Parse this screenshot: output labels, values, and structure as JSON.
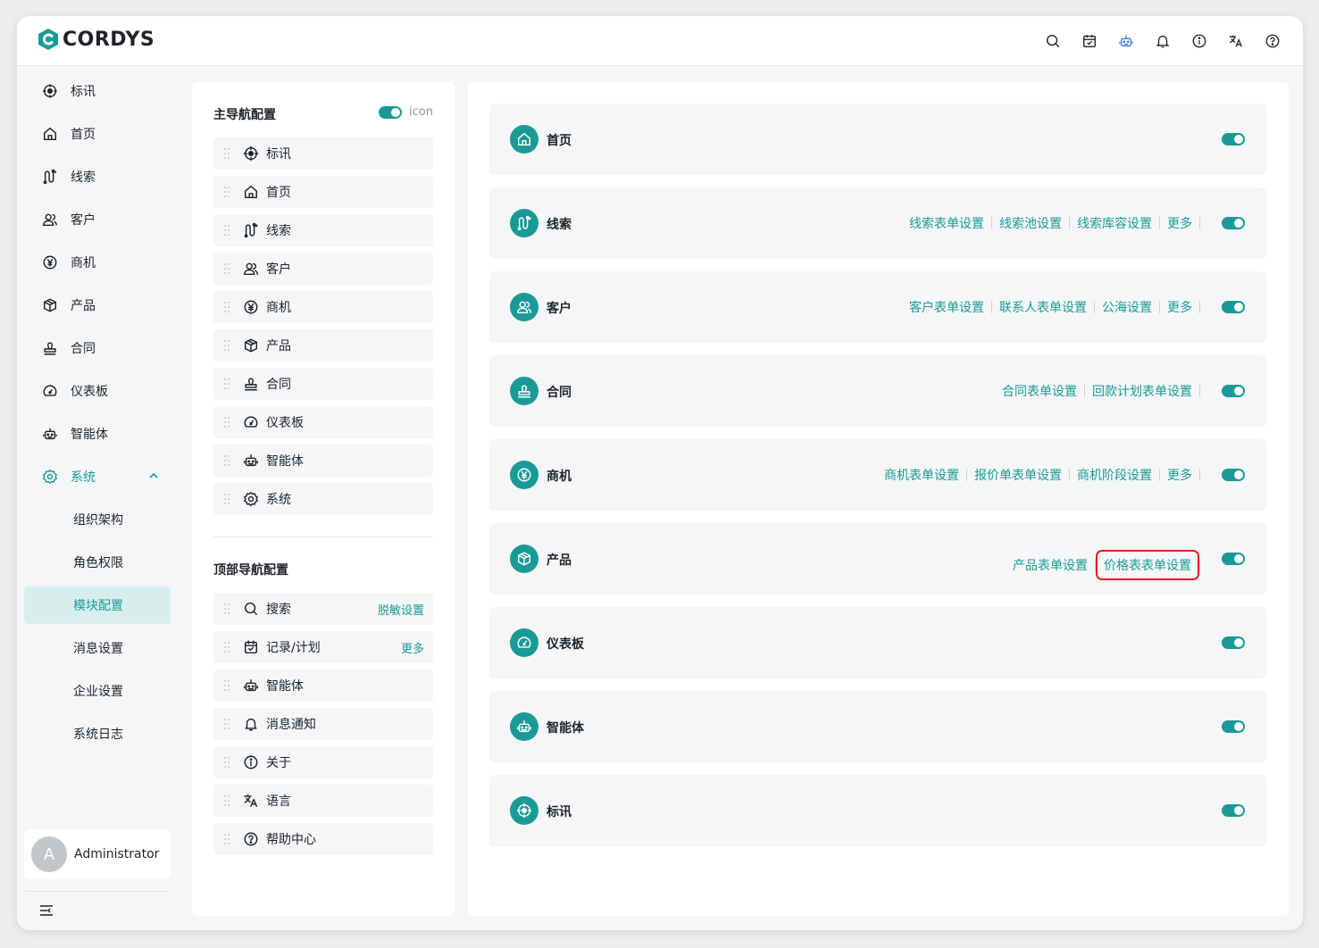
{
  "app": {
    "brand": "CORDYS",
    "accent_color": "#1a9a96"
  },
  "header": {
    "icons": [
      "search-icon",
      "calendar-check-icon",
      "robot-icon",
      "bell-icon",
      "info-icon",
      "translate-icon",
      "help-icon"
    ]
  },
  "sidebar": {
    "items": [
      {
        "label": "标讯",
        "icon": "target-icon"
      },
      {
        "label": "首页",
        "icon": "home-icon"
      },
      {
        "label": "线索",
        "icon": "route-icon"
      },
      {
        "label": "客户",
        "icon": "users-icon"
      },
      {
        "label": "商机",
        "icon": "yen-icon"
      },
      {
        "label": "产品",
        "icon": "box-icon"
      },
      {
        "label": "合同",
        "icon": "stamp-icon"
      },
      {
        "label": "仪表板",
        "icon": "dashboard-icon"
      },
      {
        "label": "智能体",
        "icon": "robot-icon"
      },
      {
        "label": "系统",
        "icon": "gear-icon",
        "expanded": true
      }
    ],
    "sub_items": [
      {
        "label": "组织架构"
      },
      {
        "label": "角色权限"
      },
      {
        "label": "模块配置",
        "active": true
      },
      {
        "label": "消息设置"
      },
      {
        "label": "企业设置"
      },
      {
        "label": "系统日志"
      }
    ],
    "user": {
      "avatar_letter": "A",
      "name": "Administrator"
    }
  },
  "main_nav": {
    "title": "主导航配置",
    "icon_toggle_label": "icon",
    "icon_toggle_on": true,
    "items": [
      {
        "label": "标讯",
        "icon": "target-icon"
      },
      {
        "label": "首页",
        "icon": "home-icon"
      },
      {
        "label": "线索",
        "icon": "route-icon"
      },
      {
        "label": "客户",
        "icon": "users-icon"
      },
      {
        "label": "商机",
        "icon": "yen-icon"
      },
      {
        "label": "产品",
        "icon": "box-icon"
      },
      {
        "label": "合同",
        "icon": "stamp-icon"
      },
      {
        "label": "仪表板",
        "icon": "dashboard-icon"
      },
      {
        "label": "智能体",
        "icon": "robot-icon"
      },
      {
        "label": "系统",
        "icon": "gear-icon"
      }
    ]
  },
  "top_nav": {
    "title": "顶部导航配置",
    "items": [
      {
        "label": "搜索",
        "icon": "search-icon",
        "link": "脱敏设置"
      },
      {
        "label": "记录/计划",
        "icon": "calendar-check-icon",
        "link": "更多"
      },
      {
        "label": "智能体",
        "icon": "robot-icon"
      },
      {
        "label": "消息通知",
        "icon": "bell-icon"
      },
      {
        "label": "关于",
        "icon": "info-icon"
      },
      {
        "label": "语言",
        "icon": "translate-icon"
      },
      {
        "label": "帮助中心",
        "icon": "help-icon"
      }
    ]
  },
  "modules": [
    {
      "name": "首页",
      "icon": "home-icon",
      "links": [],
      "enabled": true
    },
    {
      "name": "线索",
      "icon": "route-icon",
      "links": [
        "线索表单设置",
        "线索池设置",
        "线索库容设置",
        "更多"
      ],
      "enabled": true
    },
    {
      "name": "客户",
      "icon": "users-icon",
      "links": [
        "客户表单设置",
        "联系人表单设置",
        "公海设置",
        "更多"
      ],
      "enabled": true
    },
    {
      "name": "合同",
      "icon": "stamp-icon",
      "links": [
        "合同表单设置",
        "回款计划表单设置"
      ],
      "enabled": true
    },
    {
      "name": "商机",
      "icon": "yen-icon",
      "links": [
        "商机表单设置",
        "报价单表单设置",
        "商机阶段设置",
        "更多"
      ],
      "enabled": true
    },
    {
      "name": "产品",
      "icon": "box-icon",
      "links": [
        "产品表单设置",
        "价格表表单设置"
      ],
      "highlighted_link": "价格表表单设置",
      "enabled": true
    },
    {
      "name": "仪表板",
      "icon": "dashboard-icon",
      "links": [],
      "enabled": true
    },
    {
      "name": "智能体",
      "icon": "robot-icon",
      "links": [],
      "enabled": true
    },
    {
      "name": "标讯",
      "icon": "target-icon",
      "links": [],
      "enabled": true
    }
  ]
}
